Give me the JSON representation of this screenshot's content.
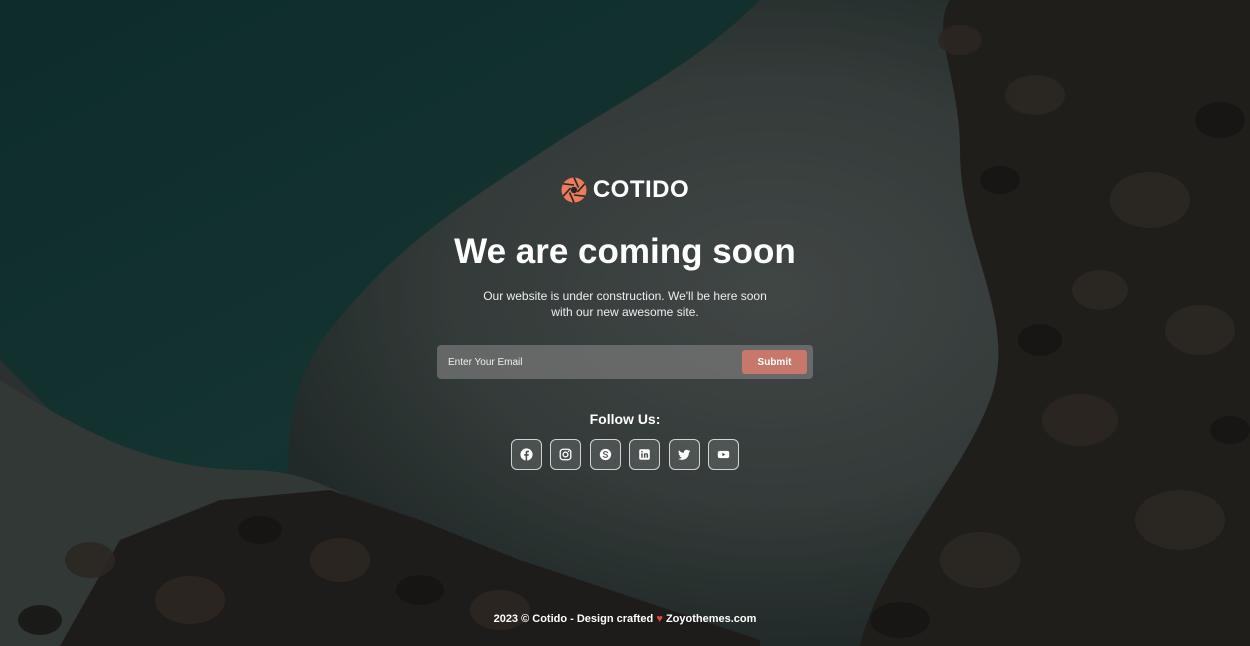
{
  "brand": {
    "name": "COTIDO",
    "logo_icon": "camera-aperture-icon",
    "logo_color": "#f07a5a"
  },
  "hero": {
    "title": "We are coming soon",
    "subtitle": "Our website is under construction. We'll be here soon with our new awesome site."
  },
  "subscribe": {
    "placeholder": "Enter Your Email",
    "value": "",
    "submit_label": "Submit",
    "submit_color": "#c8786a"
  },
  "social": {
    "title": "Follow Us:",
    "icons": [
      "facebook-icon",
      "instagram-icon",
      "skype-icon",
      "linkedin-icon",
      "twitter-icon",
      "youtube-icon"
    ]
  },
  "footer": {
    "year_copyright": "2023 © Cotido - Design crafted",
    "heart": "♥",
    "credit": "Zoyothemes.com"
  }
}
